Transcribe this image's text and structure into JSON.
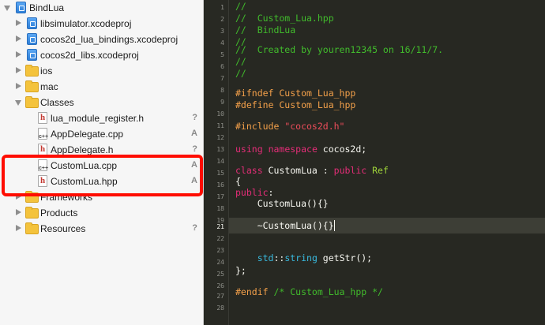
{
  "navigator": {
    "items": [
      {
        "label": "BindLua",
        "badge": ""
      },
      {
        "label": "libsimulator.xcodeproj",
        "badge": ""
      },
      {
        "label": "cocos2d_lua_bindings.xcodeproj",
        "badge": ""
      },
      {
        "label": "cocos2d_libs.xcodeproj",
        "badge": ""
      },
      {
        "label": "ios",
        "badge": ""
      },
      {
        "label": "mac",
        "badge": ""
      },
      {
        "label": "Classes",
        "badge": ""
      },
      {
        "label": "lua_module_register.h",
        "badge": "?"
      },
      {
        "label": "AppDelegate.cpp",
        "badge": "A"
      },
      {
        "label": "AppDelegate.h",
        "badge": "?"
      },
      {
        "label": "CustomLua.cpp",
        "badge": "A"
      },
      {
        "label": "CustomLua.hpp",
        "badge": "A"
      },
      {
        "label": "Frameworks",
        "badge": ""
      },
      {
        "label": "Products",
        "badge": ""
      },
      {
        "label": "Resources",
        "badge": "?"
      }
    ],
    "file_glyphs": {
      "h": "h",
      "cpp": "c++"
    }
  },
  "editor": {
    "line_numbers": [
      "1",
      "2",
      "3",
      "4",
      "5",
      "6",
      "7",
      "8",
      "9",
      "10",
      "11",
      "12",
      "13",
      "14",
      "15",
      "16",
      "17",
      "18",
      "19",
      "20",
      "21",
      "22",
      "23",
      "24",
      "25",
      "26",
      "27",
      "28"
    ],
    "current_line": "21",
    "lines": {
      "l1": "//",
      "l2": "//  Custom_Lua.hpp",
      "l3": "//  BindLua",
      "l4": "//",
      "l5": "//  Created by youren12345 on 16/11/7.",
      "l6": "//",
      "l7": "//",
      "l9": "#ifndef Custom_Lua_hpp",
      "l10": "#define Custom_Lua_hpp",
      "l12_kw": "#include ",
      "l12_str": "\"cocos2d.h\"",
      "l14_kw1": "using",
      "l14_kw2": "namespace",
      "l14_rest": " cocos2d;",
      "l16_kw": "class",
      "l16_name": " CustomLua : ",
      "l16_kw2": "public",
      "l16_base": " Ref",
      "l17": "{",
      "l18_kw": "public",
      "l18_rest": ":",
      "l19": "    CustomLua(){}",
      "l21": "    ~CustomLua(){}",
      "l24_ns": "    std",
      "l24_sep": "::",
      "l24_ty": "string",
      "l24_rest": " getStr();",
      "l25": "};",
      "l27_pp": "#endif ",
      "l27_cm": "/* Custom_Lua_hpp */"
    }
  },
  "colors": {
    "highlight_box": "#ff0d00",
    "editor_bg": "#272822",
    "comment": "#41bc2c",
    "preprocessor": "#f3a04a",
    "string": "#ee4d5b",
    "keyword": "#e52d78",
    "type": "#39bbe0"
  }
}
